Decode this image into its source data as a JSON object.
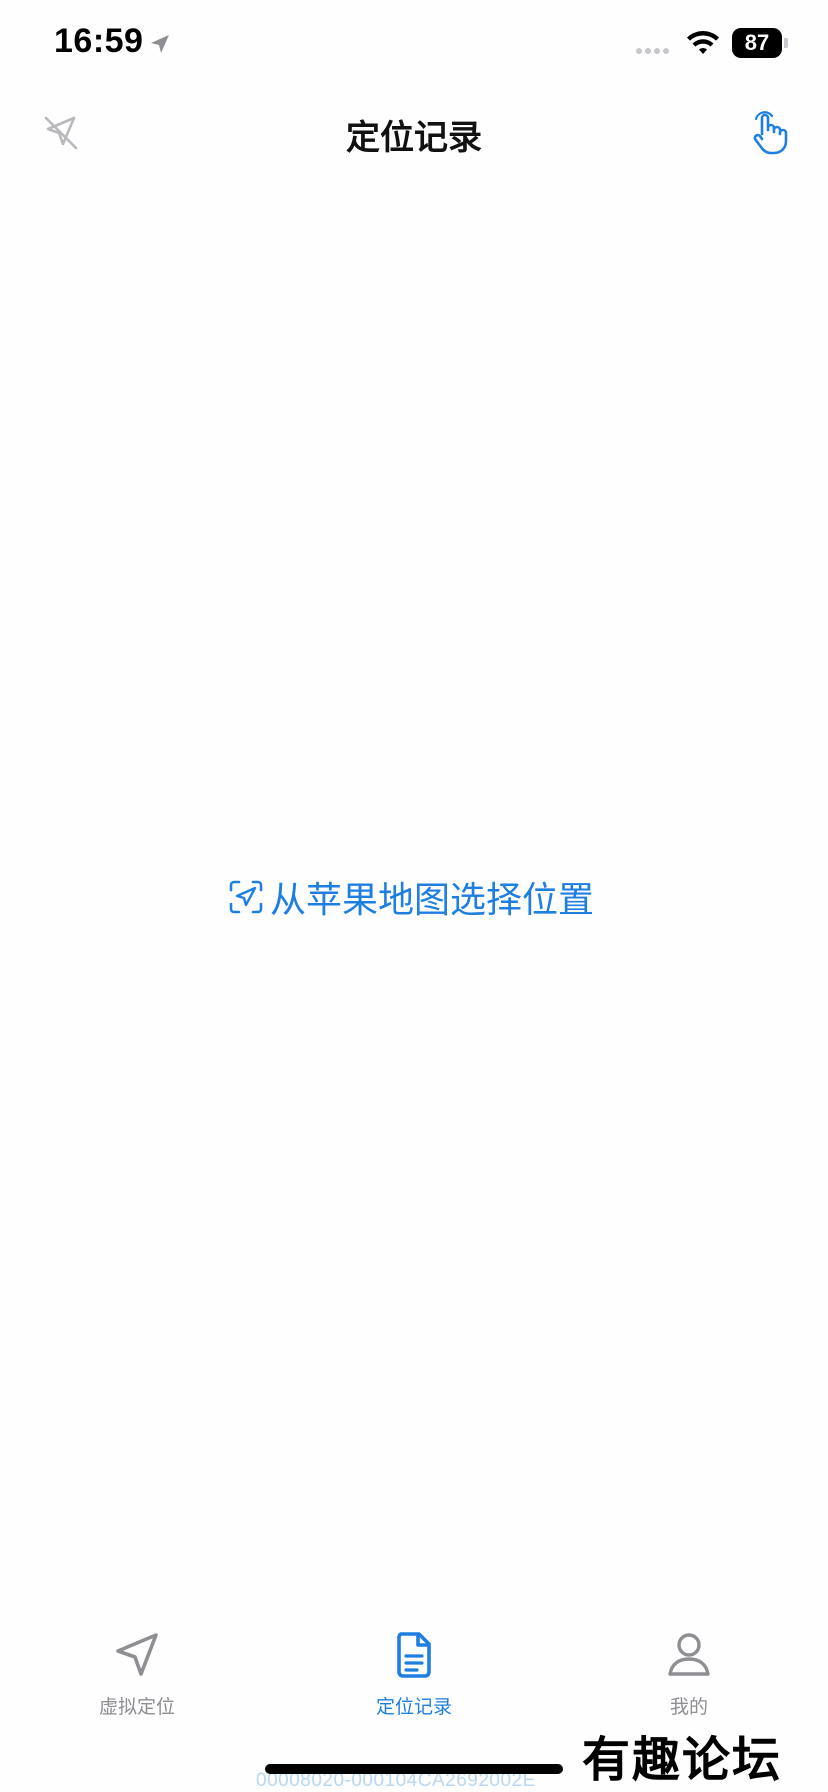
{
  "status_bar": {
    "time": "16:59",
    "battery_level": "87",
    "icons": [
      "location-arrow-icon",
      "cellular-signal-icon",
      "wifi-icon",
      "battery-icon"
    ]
  },
  "nav": {
    "title": "定位记录",
    "left_icon": "location-off-icon",
    "right_icon": "hand-pointer-icon"
  },
  "main": {
    "pick_location_label": "从苹果地图选择位置",
    "pick_location_icon": "scan-location-icon"
  },
  "tab_bar": {
    "tabs": [
      {
        "label": "虚拟定位",
        "icon": "navigation-arrow-icon",
        "active": false
      },
      {
        "label": "定位记录",
        "icon": "document-icon",
        "active": true
      },
      {
        "label": "我的",
        "icon": "person-icon",
        "active": false
      }
    ]
  },
  "footer": {
    "device_id": "00008020-000104CA2692002E",
    "watermark": "有趣论坛"
  },
  "colors": {
    "accent": "#1f7fe0",
    "inactive": "#8e8e93",
    "background": "#fefefe"
  }
}
